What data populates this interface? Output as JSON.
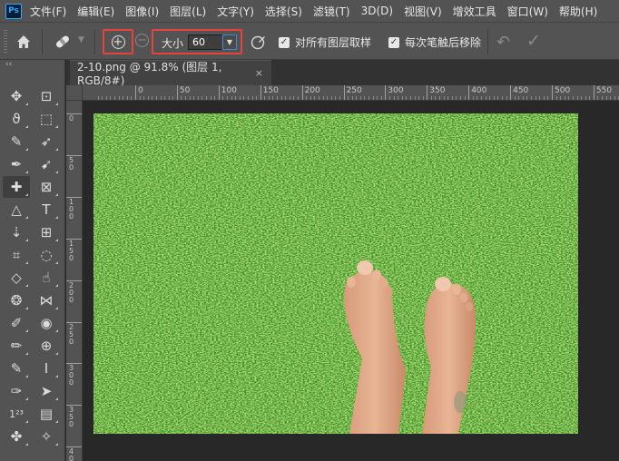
{
  "app": {
    "logo": "Ps"
  },
  "menu": [
    "文件(F)",
    "编辑(E)",
    "图像(I)",
    "图层(L)",
    "文字(Y)",
    "选择(S)",
    "滤镜(T)",
    "3D(D)",
    "视图(V)",
    "增效工具",
    "窗口(W)",
    "帮助(H)"
  ],
  "options": {
    "size_label": "大小",
    "size_value": "60",
    "sample_all_layers": "对所有图层取样",
    "sample_all_layers_checked": true,
    "remove_each_stroke": "每次笔触后移除",
    "remove_each_stroke_checked": true,
    "active_mode": "add"
  },
  "document": {
    "tab_title": "2-10.png @ 91.8% (图层 1, RGB/8#)",
    "close": "×"
  },
  "ruler": {
    "h_labels": [
      "0",
      "50",
      "100",
      "150",
      "200",
      "250",
      "300",
      "350",
      "400",
      "450",
      "500",
      "550"
    ],
    "v_labels": [
      "0",
      "5 0",
      "1 0 0",
      "1 5 0",
      "2 0 0",
      "2 5 0",
      "3 0 0",
      "3 5 0",
      "4 0 0"
    ]
  },
  "colors": {
    "highlight": "#e8423e",
    "ui_panel": "#535353",
    "workspace": "#282828",
    "grass": "#3f8f24"
  },
  "tools": [
    "move-tool",
    "artboard-tool",
    "lasso-tool",
    "object-select-tool",
    "quick-select-tool",
    "pen-arrow-tool",
    "eyedropper-tool",
    "ruler-tool",
    "remove-tool",
    "frame-tool",
    "triangle-tool",
    "vertical-type-tool",
    "vertical-type-mask-tool",
    "perspective-crop-tool",
    "crop-tool",
    "ellipse-tool",
    "paint-bucket-tool",
    "smudge-tool",
    "sponge-tool",
    "polygonal-lasso-tool",
    "brush-tool",
    "red-eye-tool",
    "pencil-tool",
    "add-anchor-tool",
    "spot-healing-tool",
    "vertical-type-tool-2",
    "freeform-pen-tool",
    "path-select-tool",
    "count-tool",
    "note-tool",
    "spot-healing-tool-2",
    "color-sampler-tool"
  ]
}
